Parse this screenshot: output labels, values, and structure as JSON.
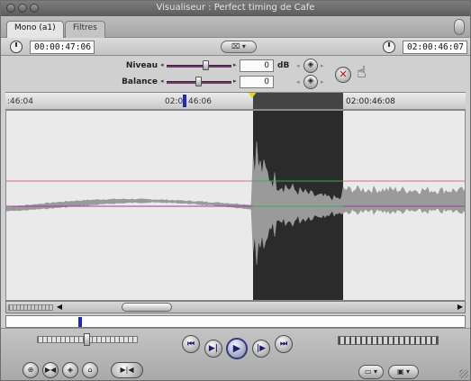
{
  "window": {
    "title": "Visualiseur : Perfect timing de Cafe"
  },
  "tabs": [
    {
      "label": "Mono (a1)",
      "active": true
    },
    {
      "label": "Filtres",
      "active": false
    }
  ],
  "timecode": {
    "duration": "00:00:47:06",
    "current": "02:00:46:07",
    "center_menu_glyph": "⌧ ▾"
  },
  "controls": {
    "level_label": "Niveau",
    "level_value": "0",
    "level_unit": "dB",
    "balance_label": "Balance",
    "balance_value": "0"
  },
  "ruler": {
    "labels": [
      ":46:04",
      "02:0",
      "46:06",
      "02:00:46:08"
    ]
  },
  "transport": {
    "buttons": [
      "prev-edit",
      "play-in-out",
      "play",
      "play-around",
      "next-edit"
    ],
    "left_buttons": [
      "insert",
      "mark-in",
      "mark-out",
      "marker",
      "match-frame"
    ]
  },
  "colors": {
    "waveform": "#9a9a9a",
    "selection": "#2b2b2b",
    "level_line": "#d46f86",
    "balance_line": "#9c3c9c",
    "playhead": "#1d2bb8",
    "in_marker": "#e9d31a"
  }
}
